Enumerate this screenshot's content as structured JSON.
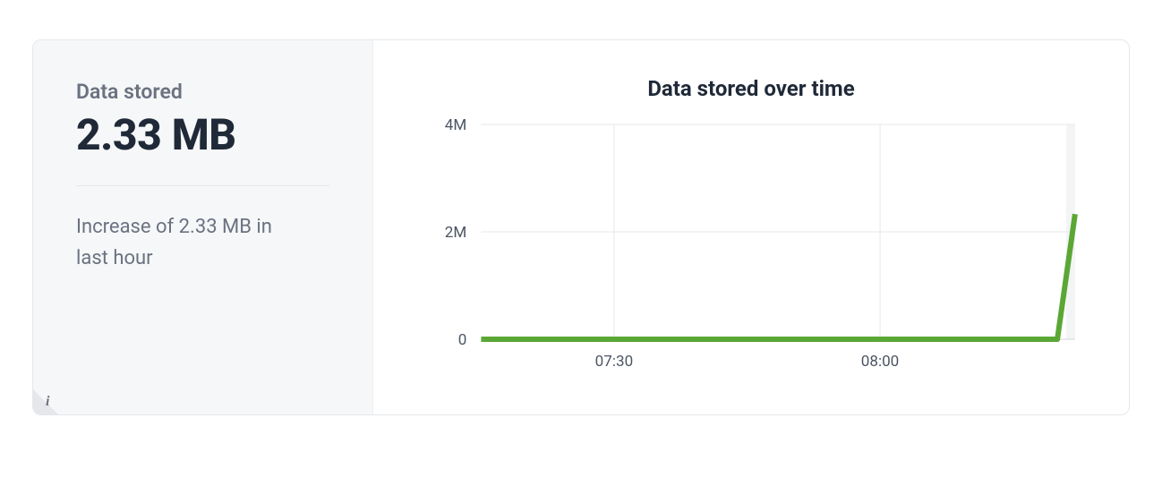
{
  "panel": {
    "title": "Data stored",
    "big_value": "2.33 MB",
    "subtext": "Increase of 2.33 MB in last hour"
  },
  "chart": {
    "title": "Data stored over time",
    "y_ticks": [
      "0",
      "2M",
      "4M"
    ],
    "x_ticks": [
      "07:30",
      "08:00"
    ]
  },
  "chart_data": {
    "type": "line",
    "title": "Data stored over time",
    "xlabel": "",
    "ylabel": "",
    "ylim": [
      0,
      4000000
    ],
    "x": [
      "07:15",
      "07:30",
      "07:45",
      "08:00",
      "08:15",
      "08:20",
      "08:22"
    ],
    "values": [
      0,
      0,
      0,
      0,
      0,
      0,
      2330000
    ],
    "series_color": "#5aa735"
  }
}
